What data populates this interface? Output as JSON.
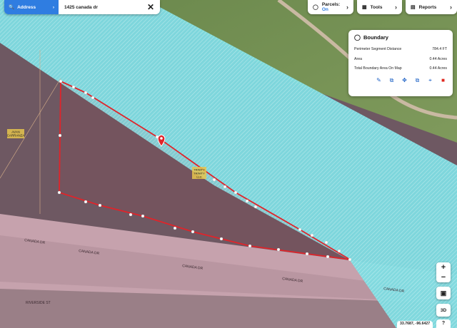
{
  "search": {
    "button_label": "Address",
    "query": "1425 canada dr"
  },
  "toolbar": {
    "parcels_label": "Parcels:",
    "parcels_state": "On",
    "tools_label": "Tools",
    "reports_label": "Reports"
  },
  "boundary_panel": {
    "title": "Boundary",
    "rows": [
      {
        "label": "Perimeter Segment Distance",
        "value": "784.4 FT"
      },
      {
        "label": "Area",
        "value": "0.44 Acres"
      },
      {
        "label": "Total Boundary Area On Map",
        "value": "0.44 Acres"
      }
    ],
    "actions": [
      "pencil-icon",
      "copy-layer-icon",
      "move-icon",
      "export-icon",
      "target-icon",
      "trash-icon"
    ]
  },
  "map": {
    "parcel_labels": [
      "AVAN",
      "CARRANZA",
      "TRINITY",
      "TRINITY",
      "LLC"
    ],
    "street_labels": [
      "CANADA DR",
      "CANADA DR",
      "CANADA DR",
      "CANADA DR",
      "CANADA DR",
      "RIVERSIDE ST"
    ],
    "colors": {
      "flood_fill": "#7ee0e4",
      "boundary": "#e0242a",
      "road": "#c7a4ad",
      "terrain": "#6e5862"
    }
  },
  "controls": {
    "zoom_in": "+",
    "zoom_out": "−",
    "three_d": "3D",
    "help": "?",
    "coords": "33.7687, -96.6427"
  }
}
